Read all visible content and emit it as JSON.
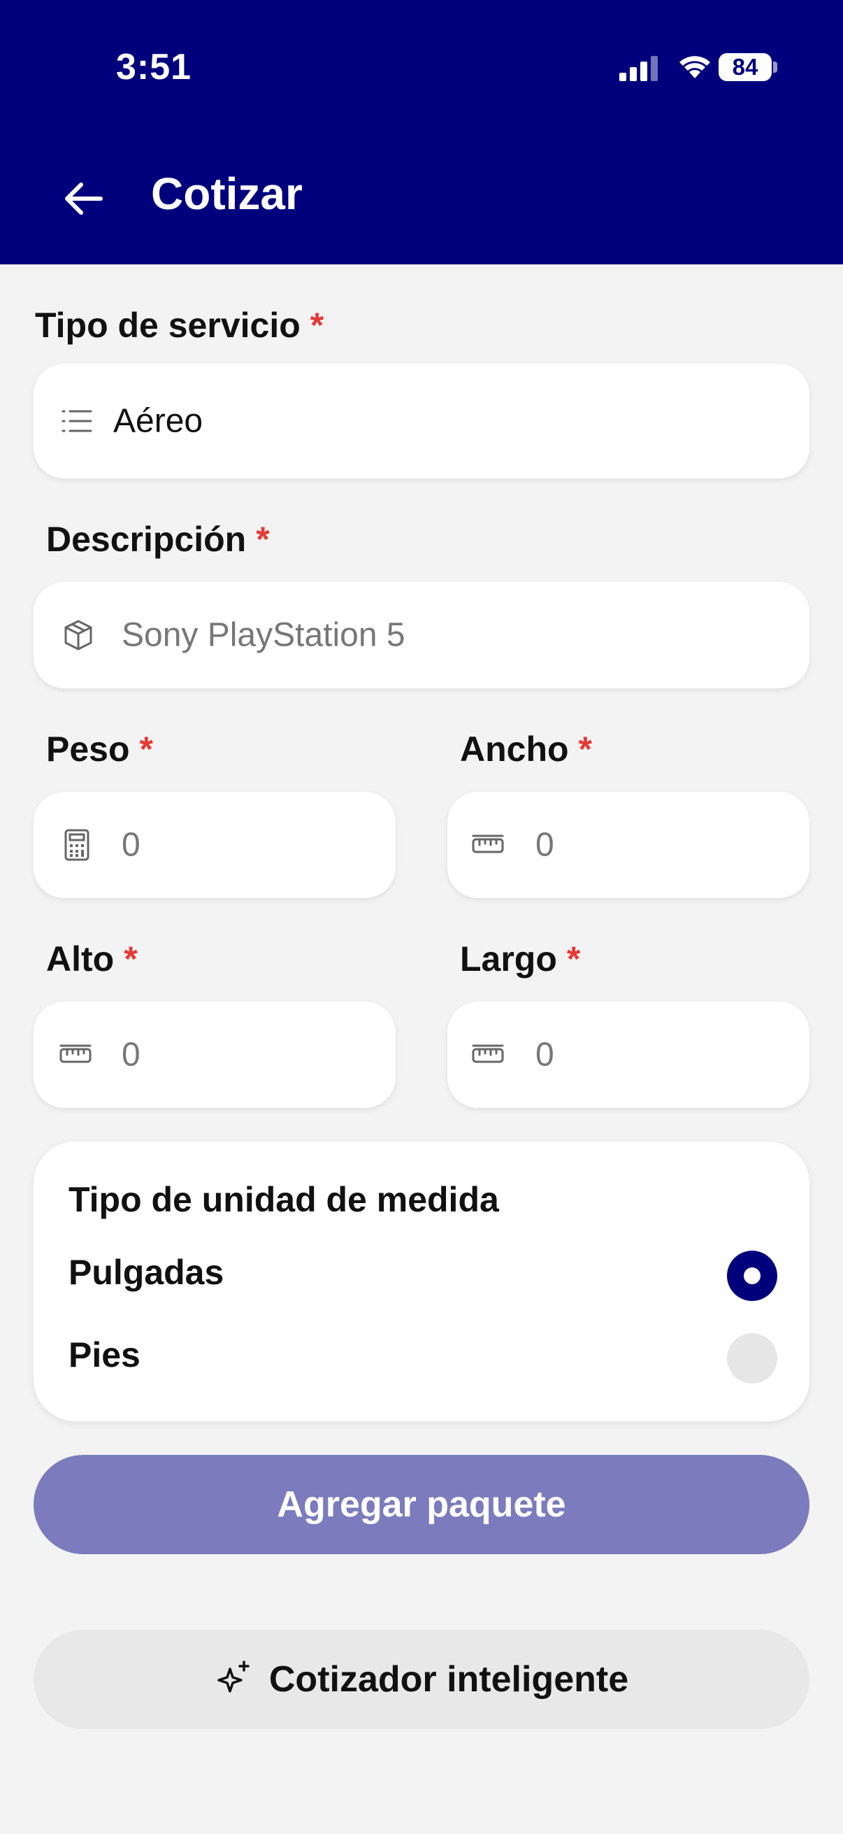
{
  "status_bar": {
    "time": "3:51",
    "battery": "84"
  },
  "header": {
    "title": "Cotizar"
  },
  "form": {
    "service_type": {
      "label": "Tipo de servicio",
      "required": "*",
      "value": "Aéreo"
    },
    "description": {
      "label": "Descripción",
      "required": "*",
      "placeholder": "Sony PlayStation 5"
    },
    "weight": {
      "label": "Peso",
      "required": "*",
      "placeholder": "0"
    },
    "width": {
      "label": "Ancho",
      "required": "*",
      "placeholder": "0"
    },
    "height": {
      "label": "Alto",
      "required": "*",
      "placeholder": "0"
    },
    "length": {
      "label": "Largo",
      "required": "*",
      "placeholder": "0"
    },
    "unit": {
      "title": "Tipo de unidad de medida",
      "options": [
        {
          "label": "Pulgadas",
          "selected": true
        },
        {
          "label": "Pies",
          "selected": false
        }
      ]
    }
  },
  "actions": {
    "add_package": "Agregar paquete",
    "smart_quote": "Cotizador inteligente"
  },
  "colors": {
    "header_bg": "#00007d",
    "required_mark": "#e53935",
    "primary_button_disabled": "#7b7bbd",
    "radio_selected": "#00007d"
  },
  "icons": {
    "back": "arrow-left-icon",
    "service": "list-icon",
    "description": "package-icon",
    "weight": "calculator-icon",
    "dimension": "ruler-icon",
    "smart": "sparkles-icon"
  }
}
